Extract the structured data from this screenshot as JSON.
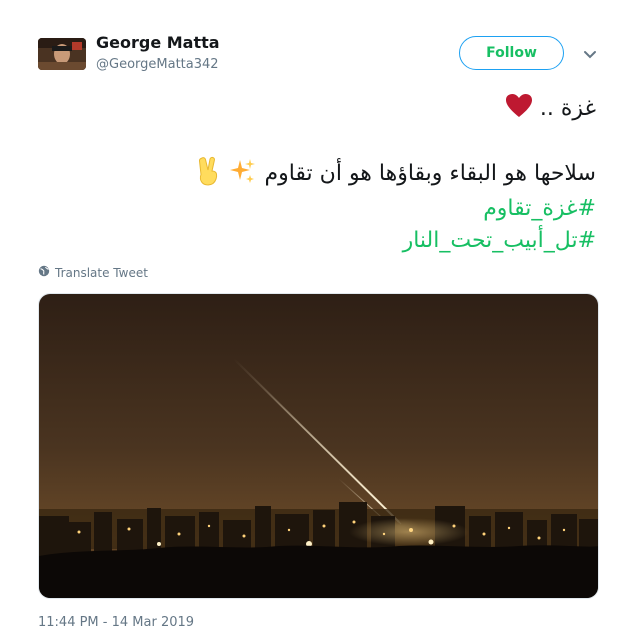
{
  "user": {
    "name": "George Matta",
    "handle": "@GeorgeMatta342"
  },
  "follow_label": "Follow",
  "tweet": {
    "line1_text": "غزة ..",
    "line2_text": "سلاحها هو البقاء وبقاؤها هو أن تقاوم",
    "hashtag1": "#غزة_تقاوم",
    "hashtag2": "#تل_أبيب_تحت_النار"
  },
  "icons": {
    "heart": "red-heart-emoji",
    "sparkles": "sparkles-emoji",
    "victory": "victory-hand-emoji",
    "globe": "globe-icon",
    "chevron": "chevron-down-icon"
  },
  "colors": {
    "accent_green": "#17bf63",
    "follow_border": "#1da1f2",
    "muted": "#657786"
  },
  "translate_label": "Translate Tweet",
  "timestamp": "11:44 PM - 14 Mar 2019"
}
